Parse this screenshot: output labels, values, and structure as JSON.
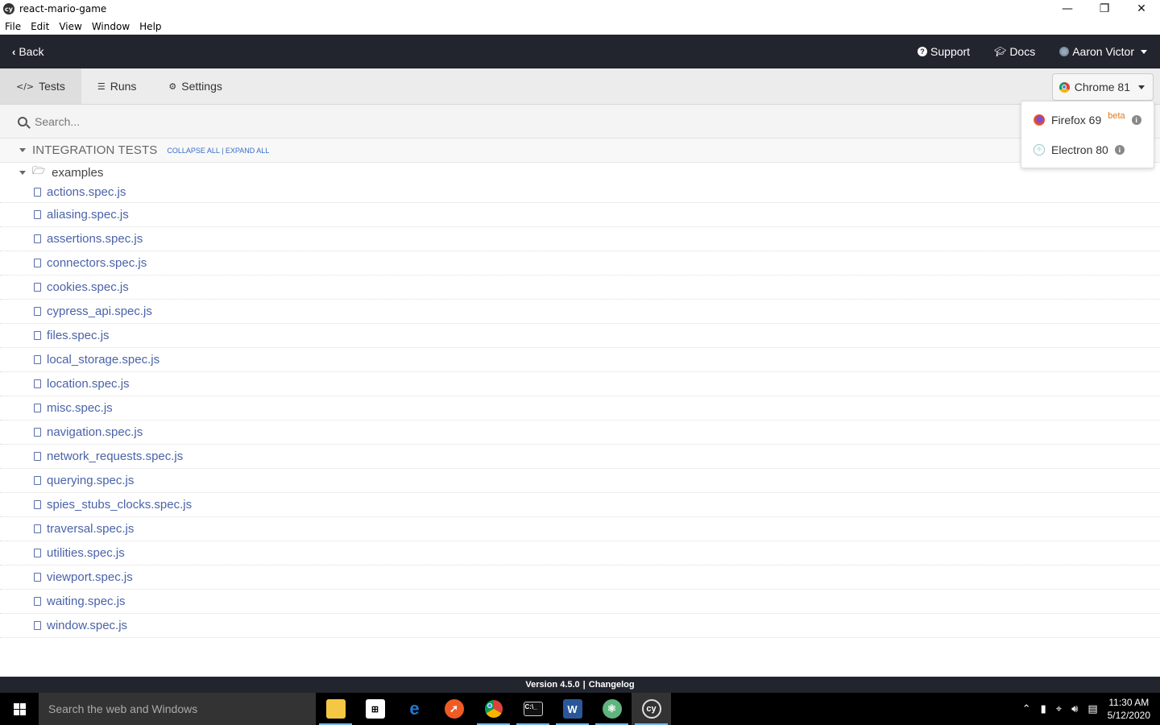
{
  "window": {
    "title": "react-mario-game",
    "app_icon": "cy",
    "controls": [
      "minimize",
      "restore",
      "close"
    ]
  },
  "menubar": {
    "items": [
      "File",
      "Edit",
      "View",
      "Window",
      "Help"
    ]
  },
  "topnav": {
    "back_label": "Back",
    "support_label": "Support",
    "docs_label": "Docs",
    "user_name": "Aaron Victor"
  },
  "tabs": [
    {
      "label": "Tests",
      "icon": "code-icon",
      "active": true
    },
    {
      "label": "Runs",
      "icon": "database-icon",
      "active": false
    },
    {
      "label": "Settings",
      "icon": "gear-icon",
      "active": false
    }
  ],
  "browser_selector": {
    "selected": "Chrome 81",
    "options": [
      {
        "label": "Firefox 69",
        "badge": "beta",
        "icon": "firefox-icon"
      },
      {
        "label": "Electron 80",
        "badge": "",
        "icon": "electron-icon"
      }
    ]
  },
  "search": {
    "placeholder": "Search...",
    "value": ""
  },
  "specs": {
    "section_title": "INTEGRATION TESTS",
    "collapse_all": "COLLAPSE ALL",
    "separator": "|",
    "expand_all": "EXPAND ALL",
    "folder": "examples",
    "files": [
      "actions.spec.js",
      "aliasing.spec.js",
      "assertions.spec.js",
      "connectors.spec.js",
      "cookies.spec.js",
      "cypress_api.spec.js",
      "files.spec.js",
      "local_storage.spec.js",
      "location.spec.js",
      "misc.spec.js",
      "navigation.spec.js",
      "network_requests.spec.js",
      "querying.spec.js",
      "spies_stubs_clocks.spec.js",
      "traversal.spec.js",
      "utilities.spec.js",
      "viewport.spec.js",
      "waiting.spec.js",
      "window.spec.js"
    ]
  },
  "footer": {
    "version": "Version 4.5.0",
    "separator": "|",
    "changelog": "Changelog"
  },
  "taskbar": {
    "search_placeholder": "Search the web and Windows",
    "apps": [
      "file-explorer",
      "store",
      "edge",
      "postman",
      "chrome",
      "terminal",
      "word",
      "atom",
      "cypress"
    ],
    "time": "11:30 AM",
    "date": "5/12/2020"
  },
  "colors": {
    "nav_bg": "#22242e",
    "link_blue": "#4a63a8",
    "beta_orange": "#e07b1a"
  }
}
